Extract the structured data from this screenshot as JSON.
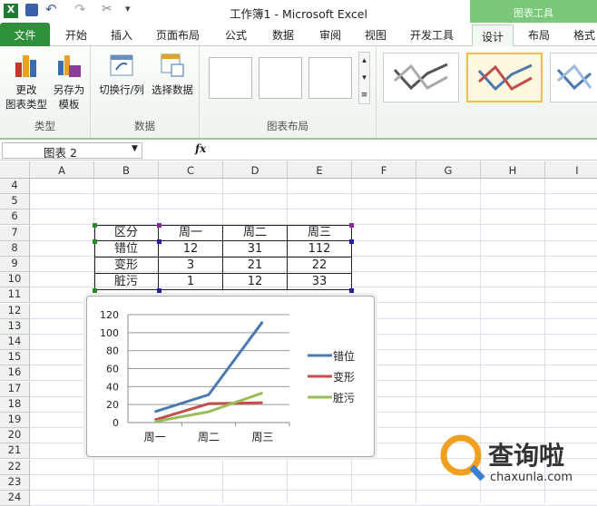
{
  "window": {
    "title": "工作簿1 - Microsoft Excel",
    "context_header": "图表工具"
  },
  "tabs": [
    "文件",
    "开始",
    "插入",
    "页面布局",
    "公式",
    "数据",
    "审阅",
    "视图",
    "开发工具",
    "设计",
    "布局",
    "格式"
  ],
  "ribbon": {
    "type_group": {
      "label": "类型",
      "change_type": [
        "更改",
        "图表类型"
      ],
      "save_template": [
        "另存为",
        "模板"
      ]
    },
    "data_group": {
      "label": "数据",
      "switch": "切换行/列",
      "select": "选择数据"
    },
    "layout_group": {
      "label": "图表布局"
    }
  },
  "formula_bar": {
    "name_box": "图表 2",
    "fx": "fx"
  },
  "columns": [
    "A",
    "B",
    "C",
    "D",
    "E",
    "F",
    "G",
    "H",
    "I"
  ],
  "rows": [
    "4",
    "5",
    "6",
    "7",
    "8",
    "9",
    "10",
    "11",
    "12",
    "13",
    "14",
    "15",
    "16",
    "17",
    "18",
    "19",
    "20",
    "21",
    "22",
    "23",
    "24"
  ],
  "table": {
    "header": [
      "区分",
      "周一",
      "周二",
      "周三"
    ],
    "rows": [
      [
        "错位",
        "12",
        "31",
        "112"
      ],
      [
        "变形",
        "3",
        "21",
        "22"
      ],
      [
        "脏污",
        "1",
        "12",
        "33"
      ]
    ]
  },
  "chart_data": {
    "type": "line",
    "categories": [
      "周一",
      "周二",
      "周三"
    ],
    "series": [
      {
        "name": "错位",
        "values": [
          12,
          31,
          112
        ],
        "color": "#4a7ab0"
      },
      {
        "name": "变形",
        "values": [
          3,
          21,
          22
        ],
        "color": "#c0504d"
      },
      {
        "name": "脏污",
        "values": [
          1,
          12,
          33
        ],
        "color": "#9bbb59"
      }
    ],
    "ylim": [
      0,
      120
    ],
    "yticks": [
      "0",
      "20",
      "40",
      "60",
      "80",
      "100",
      "120"
    ],
    "grid": true,
    "legend": "right"
  },
  "watermark": {
    "name": "查询啦",
    "url": "chaxunla.com"
  }
}
